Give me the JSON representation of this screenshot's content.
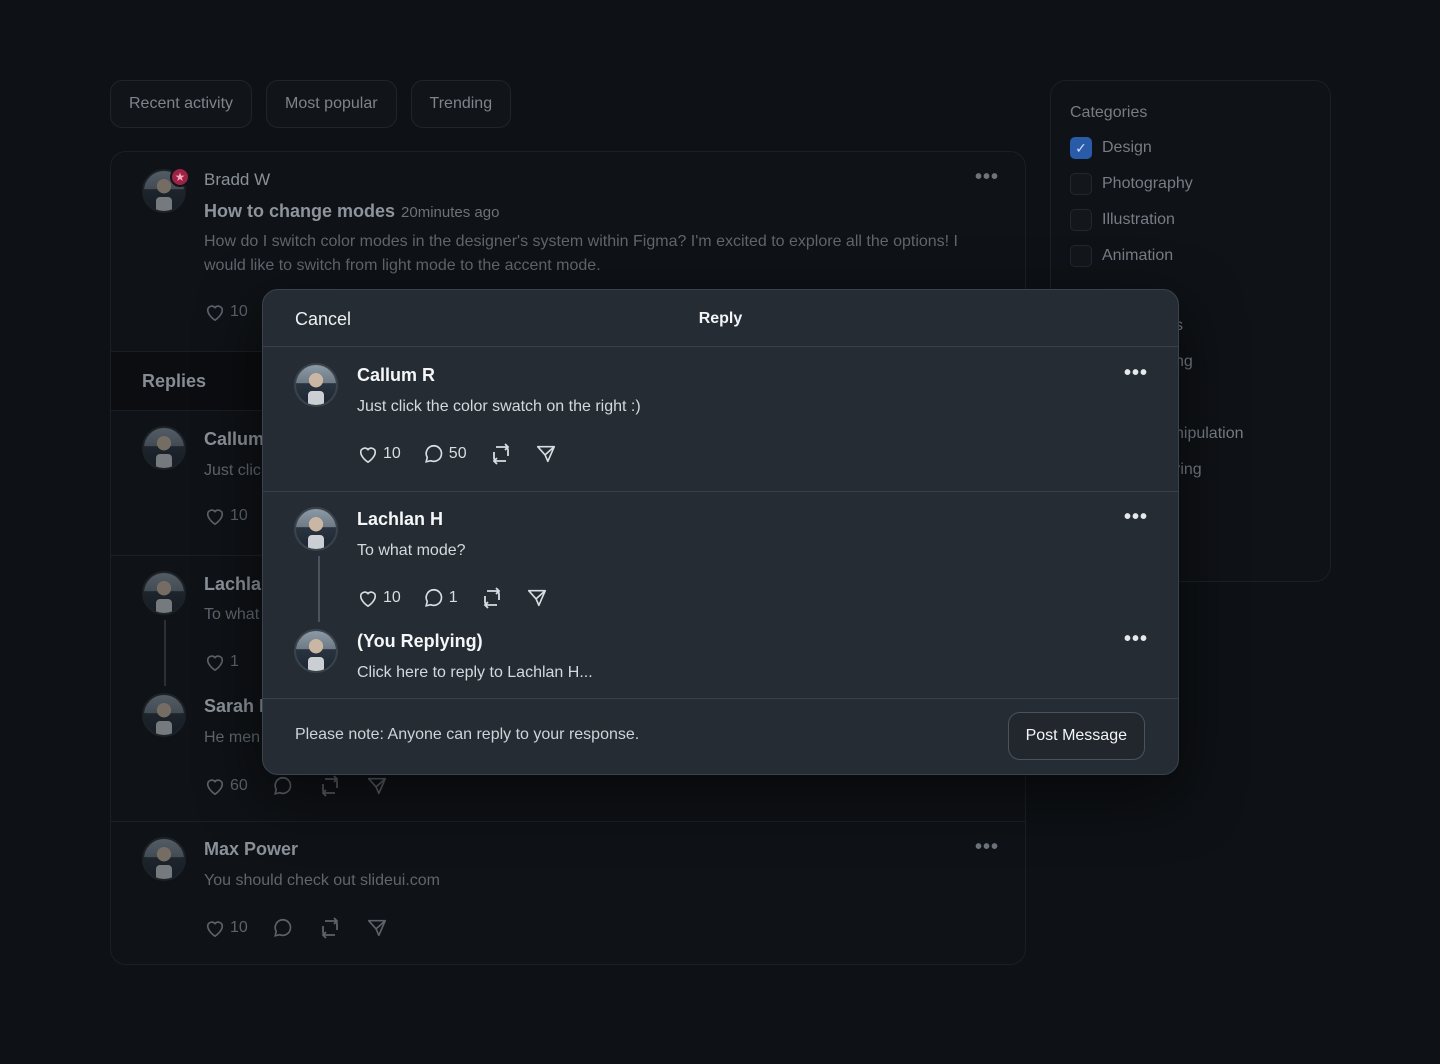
{
  "tabs": [
    "Recent activity",
    "Most popular",
    "Trending"
  ],
  "feed": {
    "main_post": {
      "author": "Bradd W",
      "title": "How to change modes",
      "time": "20minutes ago",
      "body": "How do I switch color modes in the designer's system within Figma? I'm excited to explore all the options! I would like to switch from light mode to the accent mode.",
      "likes": "10"
    },
    "replies_label": "Replies",
    "replies": [
      {
        "author": "Callum",
        "text": "Just clic",
        "likes": "10"
      },
      {
        "author": "Lachla",
        "text": "To what",
        "likes": "1"
      },
      {
        "author": "Sarah I",
        "text": "He men",
        "likes": "60"
      }
    ],
    "last_post": {
      "author": "Max Power",
      "text": "You should check out slideui.com",
      "likes": "10"
    }
  },
  "categories": {
    "title": "Categories",
    "items": [
      {
        "label": "Design",
        "checked": true
      },
      {
        "label": "Photography",
        "checked": false
      },
      {
        "label": "Illustration",
        "checked": false
      },
      {
        "label": "Animation",
        "checked": false
      }
    ],
    "fragments": [
      "s",
      "ng",
      "nipulation",
      "ring"
    ]
  },
  "modal": {
    "cancel": "Cancel",
    "title": "Reply",
    "posts": [
      {
        "author": "Callum R",
        "text": "Just click the color swatch on the right :)",
        "likes": "10",
        "comments": "50"
      },
      {
        "author": "Lachlan H",
        "text": "To what mode?",
        "likes": "10",
        "comments": "1"
      }
    ],
    "reply": {
      "author": "(You Replying)",
      "placeholder": "Click here to reply to Lachlan H..."
    },
    "note": "Please note: Anyone can reply to your response.",
    "post_button": "Post Message"
  },
  "colors": {
    "accent": "#2a5ba8",
    "modal_bg": "#252c33",
    "page_bg": "#0e1115",
    "badge": "#9c2344"
  }
}
